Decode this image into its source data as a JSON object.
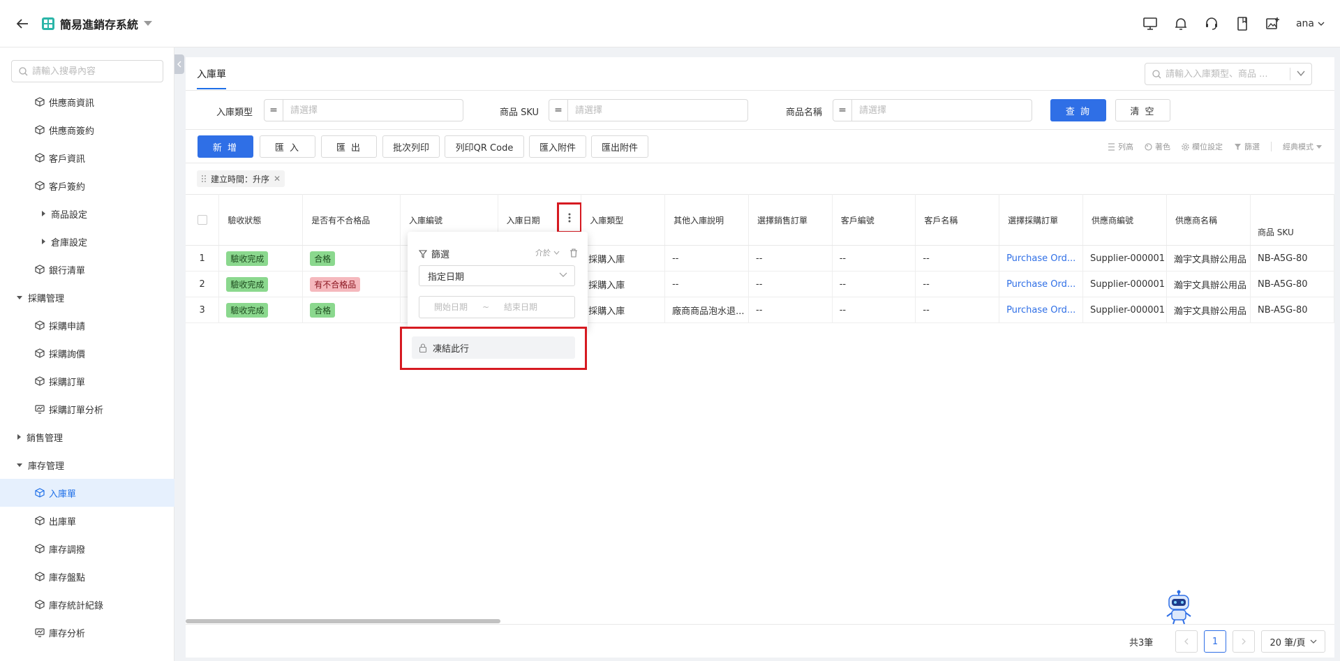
{
  "header": {
    "app_title": "簡易進銷存系統",
    "user": "ana"
  },
  "sidebar": {
    "search_placeholder": "請輸入搜尋內容",
    "items": [
      {
        "label": "供應商資訊",
        "type": "leaf"
      },
      {
        "label": "供應商簽約",
        "type": "leaf"
      },
      {
        "label": "客戶資訊",
        "type": "leaf"
      },
      {
        "label": "客戶簽約",
        "type": "leaf"
      },
      {
        "label": "商品設定",
        "type": "group-collapsed"
      },
      {
        "label": "倉庫設定",
        "type": "group-collapsed"
      },
      {
        "label": "銀行清單",
        "type": "leaf"
      },
      {
        "label": "採購管理",
        "type": "section-expanded"
      },
      {
        "label": "採購申請",
        "type": "leaf"
      },
      {
        "label": "採購詢價",
        "type": "leaf"
      },
      {
        "label": "採購訂單",
        "type": "leaf"
      },
      {
        "label": "採購訂單分析",
        "type": "chart-leaf"
      },
      {
        "label": "銷售管理",
        "type": "section-collapsed"
      },
      {
        "label": "庫存管理",
        "type": "section-expanded"
      },
      {
        "label": "入庫單",
        "type": "leaf",
        "active": true
      },
      {
        "label": "出庫單",
        "type": "leaf"
      },
      {
        "label": "庫存調撥",
        "type": "leaf"
      },
      {
        "label": "庫存盤點",
        "type": "leaf"
      },
      {
        "label": "庫存統計紀錄",
        "type": "leaf"
      },
      {
        "label": "庫存分析",
        "type": "chart-leaf"
      }
    ]
  },
  "tab": {
    "label": "入庫單",
    "search_placeholder": "請輸入入庫類型、商品 ..."
  },
  "filters": {
    "f1_label": "入庫類型",
    "f2_label": "商品 SKU",
    "f3_label": "商品名稱",
    "op": "=",
    "placeholder": "請選擇",
    "query": "查 詢",
    "clear": "清 空"
  },
  "toolbar": {
    "add": "新 增",
    "import": "匯 入",
    "export": "匯 出",
    "batch_print": "批次列印",
    "print_qr": "列印QR Code",
    "import_attach": "匯入附件",
    "export_attach": "匯出附件",
    "row_height": "列高",
    "color": "著色",
    "column_settings": "欄位設定",
    "filter": "篩選",
    "mode": "經典模式"
  },
  "sort_chip": "建立時間：升序",
  "table": {
    "columns": [
      "驗收狀態",
      "是否有不合格品",
      "入庫編號",
      "入庫日期",
      "入庫類型",
      "其他入庫說明",
      "選擇銷售訂單",
      "客戶編號",
      "客戶名稱",
      "選擇採購訂單",
      "供應商編號",
      "供應商名稱",
      "商品 SKU"
    ],
    "rows": [
      {
        "no": "1",
        "status": "驗收完成",
        "defect": "合格",
        "defect_bad": false,
        "type": "採購入庫",
        "other": "--",
        "sales_order": "--",
        "cust_no": "--",
        "cust_name": "--",
        "po": "Purchase Ord...",
        "supplier_no": "Supplier-000001",
        "supplier_name": "瀚宇文具辦公用品",
        "sku": "NB-A5G-80"
      },
      {
        "no": "2",
        "status": "驗收完成",
        "defect": "有不合格品",
        "defect_bad": true,
        "type": "採購入庫",
        "other": "--",
        "sales_order": "--",
        "cust_no": "--",
        "cust_name": "--",
        "po": "Purchase Ord...",
        "supplier_no": "Supplier-000001",
        "supplier_name": "瀚宇文具辦公用品",
        "sku": "NB-A5G-80"
      },
      {
        "no": "3",
        "status": "驗收完成",
        "defect": "合格",
        "defect_bad": false,
        "type": "採購入庫",
        "other": "廠商商品泡水退...",
        "sales_order": "--",
        "cust_no": "--",
        "cust_name": "--",
        "po": "Purchase Ord...",
        "supplier_no": "Supplier-000001",
        "supplier_name": "瀚宇文具辦公用品",
        "sku": "NB-A5G-80"
      }
    ]
  },
  "popup": {
    "filter_label": "篩選",
    "between": "介於",
    "select_value": "指定日期",
    "start_placeholder": "開始日期",
    "tilde": "~",
    "end_placeholder": "結束日期",
    "freeze": "凍結此行"
  },
  "pagination": {
    "total": "共3筆",
    "current": "1",
    "page_size": "20 筆/頁"
  },
  "colors": {
    "primary": "#2f6fe6",
    "highlight": "#d61a21",
    "tag_green": "#8bd88e",
    "tag_red": "#f5b8bd"
  }
}
